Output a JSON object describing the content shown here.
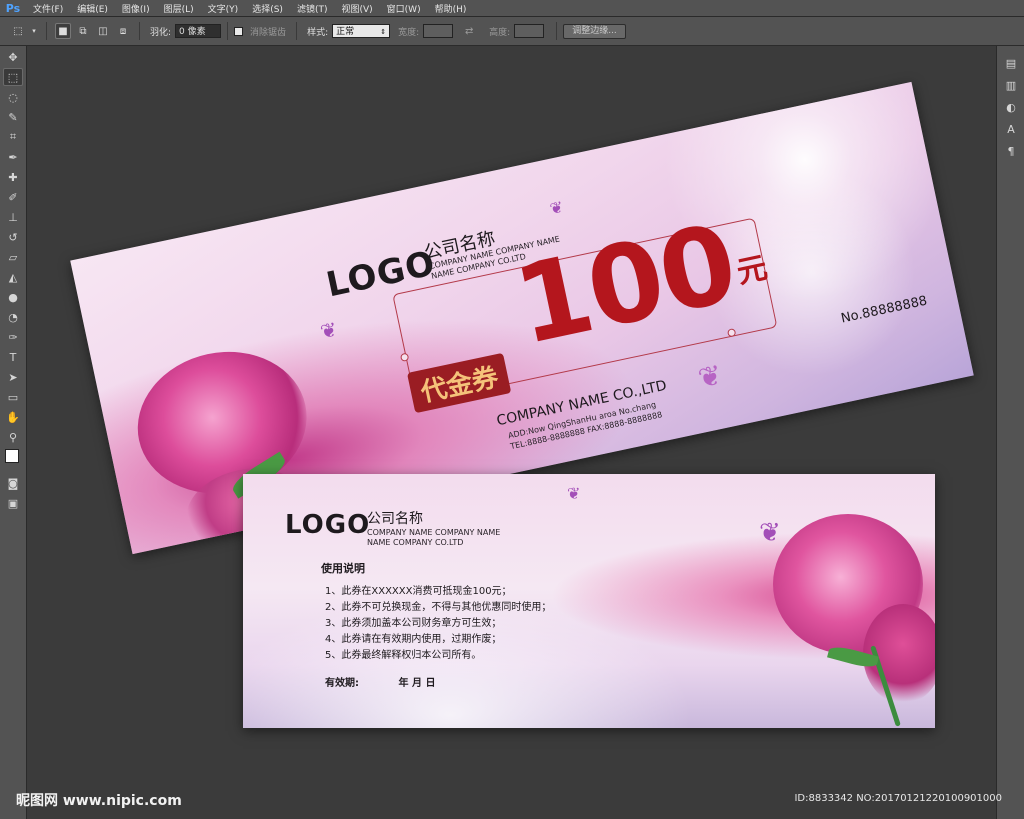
{
  "app": {
    "logo": "Ps"
  },
  "menu": [
    "文件(F)",
    "编辑(E)",
    "图像(I)",
    "图层(L)",
    "文字(Y)",
    "选择(S)",
    "滤镜(T)",
    "视图(V)",
    "窗口(W)",
    "帮助(H)"
  ],
  "options": {
    "feather_label": "羽化:",
    "feather_value": "0 像素",
    "antialias_label": "消除锯齿",
    "style_label": "样式:",
    "style_value": "正常",
    "width_label": "宽度:",
    "height_label": "高度:",
    "refine_button": "调整边缘..."
  },
  "front": {
    "logo": "LOGO",
    "company_cn": "公司名称",
    "company_en_line1": "COMPANY NAME COMPANY NAME",
    "company_en_line2": "NAME COMPANY CO.LTD",
    "amount": "100",
    "currency": "元",
    "voucher": "代金券",
    "serial": "No.88888888",
    "company_en": "COMPANY NAME CO.,LTD",
    "address": "ADD:Now QingShanHu aroa No.chang",
    "contact": "TEL:8888-8888888    FAX:8888-8888888"
  },
  "back": {
    "logo": "LOGO",
    "company_cn": "公司名称",
    "company_en_line1": "COMPANY NAME COMPANY NAME",
    "company_en_line2": "NAME COMPANY CO.LTD",
    "usage_title": "使用说明",
    "rules": [
      "1、此券在XXXXXX消费可抵现金100元；",
      "2、此券不可兑换现金，不得与其他优惠同时使用；",
      "3、此券须加盖本公司财务章方可生效；",
      "4、此券请在有效期内使用，过期作废；",
      "5、此券最终解释权归本公司所有。"
    ],
    "valid_label": "有效期:",
    "valid_date": "年    月    日"
  },
  "watermark": {
    "left": "昵图网 www.nipic.com",
    "right": "ID:8833342 NO:20170121220100901000"
  }
}
